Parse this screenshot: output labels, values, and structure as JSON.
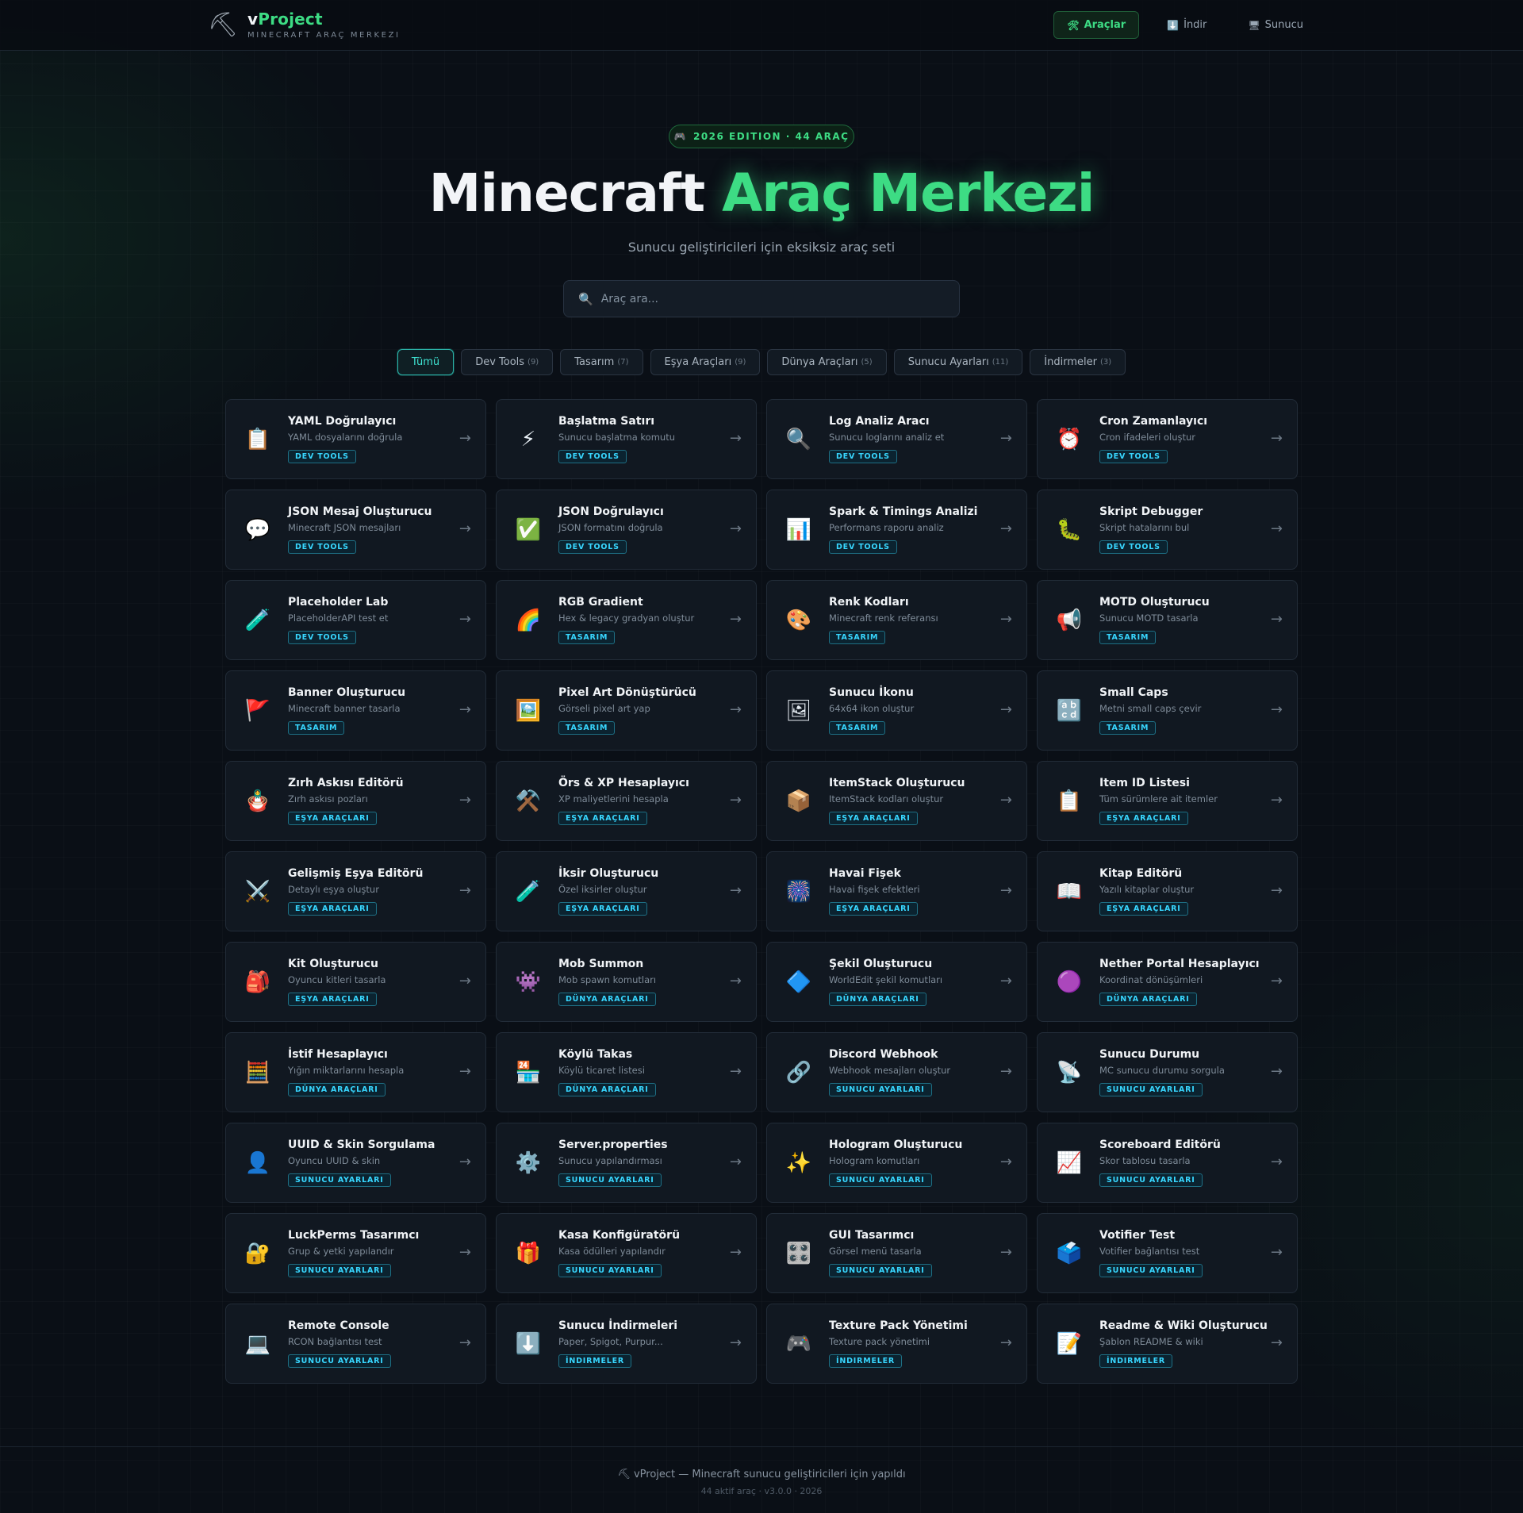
{
  "header": {
    "brand_icon": "⛏",
    "brand_prefix": "v",
    "brand_name": "Project",
    "brand_sub": "MINECRAFT ARAÇ MERKEZI",
    "nav": [
      {
        "icon": "🛠",
        "label": "Araçlar",
        "active": true
      },
      {
        "icon": "⬇️",
        "label": "İndir",
        "active": false
      },
      {
        "icon": "🖥",
        "label": "Sunucu",
        "active": false
      }
    ]
  },
  "hero": {
    "badge_icon": "🎮",
    "badge_text": "2026 EDITION · 44 ARAÇ",
    "title_white": "Minecraft ",
    "title_green": "Araç Merkezi",
    "subtitle": "Sunucu geliştiricileri için eksiksiz araç seti"
  },
  "search": {
    "placeholder": "Araç ara...",
    "value": ""
  },
  "filters": [
    {
      "label": "Tümü",
      "count": "",
      "active": true
    },
    {
      "label": "Dev Tools",
      "count": "(9)",
      "active": false
    },
    {
      "label": "Tasarım",
      "count": "(7)",
      "active": false
    },
    {
      "label": "Eşya Araçları",
      "count": "(9)",
      "active": false
    },
    {
      "label": "Dünya Araçları",
      "count": "(5)",
      "active": false
    },
    {
      "label": "Sunucu Ayarları",
      "count": "(11)",
      "active": false
    },
    {
      "label": "İndirmeler",
      "count": "(3)",
      "active": false
    }
  ],
  "tools": [
    {
      "icon": "📋",
      "title": "YAML Doğrulayıcı",
      "desc": "YAML dosyalarını doğrula",
      "tag": "DEV TOOLS"
    },
    {
      "icon": "⚡",
      "title": "Başlatma Satırı",
      "desc": "Sunucu başlatma komutu",
      "tag": "DEV TOOLS"
    },
    {
      "icon": "🔍",
      "title": "Log Analiz Aracı",
      "desc": "Sunucu loglarını analiz et",
      "tag": "DEV TOOLS"
    },
    {
      "icon": "⏰",
      "title": "Cron Zamanlayıcı",
      "desc": "Cron ifadeleri oluştur",
      "tag": "DEV TOOLS"
    },
    {
      "icon": "💬",
      "title": "JSON Mesaj Oluşturucu",
      "desc": "Minecraft JSON mesajları",
      "tag": "DEV TOOLS"
    },
    {
      "icon": "✅",
      "title": "JSON Doğrulayıcı",
      "desc": "JSON formatını doğrula",
      "tag": "DEV TOOLS"
    },
    {
      "icon": "📊",
      "title": "Spark & Timings Analizi",
      "desc": "Performans raporu analiz",
      "tag": "DEV TOOLS"
    },
    {
      "icon": "🐛",
      "title": "Skript Debugger",
      "desc": "Skript hatalarını bul",
      "tag": "DEV TOOLS"
    },
    {
      "icon": "🧪",
      "title": "Placeholder Lab",
      "desc": "PlaceholderAPI test et",
      "tag": "DEV TOOLS"
    },
    {
      "icon": "🌈",
      "title": "RGB Gradient",
      "desc": "Hex & legacy gradyan oluştur",
      "tag": "TASARIM"
    },
    {
      "icon": "🎨",
      "title": "Renk Kodları",
      "desc": "Minecraft renk referansı",
      "tag": "TASARIM"
    },
    {
      "icon": "📢",
      "title": "MOTD Oluşturucu",
      "desc": "Sunucu MOTD tasarla",
      "tag": "TASARIM"
    },
    {
      "icon": "🚩",
      "title": "Banner Oluşturucu",
      "desc": "Minecraft banner tasarla",
      "tag": "TASARIM"
    },
    {
      "icon": "🖼️",
      "title": "Pixel Art Dönüştürücü",
      "desc": "Görseli pixel art yap",
      "tag": "TASARIM"
    },
    {
      "icon": "🖼",
      "title": "Sunucu İkonu",
      "desc": "64x64 ikon oluştur",
      "tag": "TASARIM"
    },
    {
      "icon": "🔡",
      "title": "Small Caps",
      "desc": "Metni small caps çevir",
      "tag": "TASARIM"
    },
    {
      "icon": "🪆",
      "title": "Zırh Askısı Editörü",
      "desc": "Zırh askısı pozları",
      "tag": "EŞYA ARAÇLARI"
    },
    {
      "icon": "⚒️",
      "title": "Örs & XP Hesaplayıcı",
      "desc": "XP maliyetlerini hesapla",
      "tag": "EŞYA ARAÇLARI"
    },
    {
      "icon": "📦",
      "title": "ItemStack Oluşturucu",
      "desc": "ItemStack kodları oluştur",
      "tag": "EŞYA ARAÇLARI"
    },
    {
      "icon": "📋",
      "title": "Item ID Listesi",
      "desc": "Tüm sürümlere ait itemler",
      "tag": "EŞYA ARAÇLARI"
    },
    {
      "icon": "⚔️",
      "title": "Gelişmiş Eşya Editörü",
      "desc": "Detaylı eşya oluştur",
      "tag": "EŞYA ARAÇLARI"
    },
    {
      "icon": "🧪",
      "title": "İksir Oluşturucu",
      "desc": "Özel iksirler oluştur",
      "tag": "EŞYA ARAÇLARI"
    },
    {
      "icon": "🎆",
      "title": "Havai Fişek",
      "desc": "Havai fişek efektleri",
      "tag": "EŞYA ARAÇLARI"
    },
    {
      "icon": "📖",
      "title": "Kitap Editörü",
      "desc": "Yazılı kitaplar oluştur",
      "tag": "EŞYA ARAÇLARI"
    },
    {
      "icon": "🎒",
      "title": "Kit Oluşturucu",
      "desc": "Oyuncu kitleri tasarla",
      "tag": "EŞYA ARAÇLARI"
    },
    {
      "icon": "👾",
      "title": "Mob Summon",
      "desc": "Mob spawn komutları",
      "tag": "DÜNYA ARAÇLARI"
    },
    {
      "icon": "🔷",
      "title": "Şekil Oluşturucu",
      "desc": "WorldEdit şekil komutları",
      "tag": "DÜNYA ARAÇLARI"
    },
    {
      "icon": "🟣",
      "title": "Nether Portal Hesaplayıcı",
      "desc": "Koordinat dönüşümleri",
      "tag": "DÜNYA ARAÇLARI"
    },
    {
      "icon": "🧮",
      "title": "İstif Hesaplayıcı",
      "desc": "Yığın miktarlarını hesapla",
      "tag": "DÜNYA ARAÇLARI"
    },
    {
      "icon": "🏪",
      "title": "Köylü Takas",
      "desc": "Köylü ticaret listesi",
      "tag": "DÜNYA ARAÇLARI"
    },
    {
      "icon": "🔗",
      "title": "Discord Webhook",
      "desc": "Webhook mesajları oluştur",
      "tag": "SUNUCU AYARLARI"
    },
    {
      "icon": "📡",
      "title": "Sunucu Durumu",
      "desc": "MC sunucu durumu sorgula",
      "tag": "SUNUCU AYARLARI"
    },
    {
      "icon": "👤",
      "title": "UUID & Skin Sorgulama",
      "desc": "Oyuncu UUID & skin",
      "tag": "SUNUCU AYARLARI"
    },
    {
      "icon": "⚙️",
      "title": "Server.properties",
      "desc": "Sunucu yapılandırması",
      "tag": "SUNUCU AYARLARI"
    },
    {
      "icon": "✨",
      "title": "Hologram Oluşturucu",
      "desc": "Hologram komutları",
      "tag": "SUNUCU AYARLARI"
    },
    {
      "icon": "📈",
      "title": "Scoreboard Editörü",
      "desc": "Skor tablosu tasarla",
      "tag": "SUNUCU AYARLARI"
    },
    {
      "icon": "🔐",
      "title": "LuckPerms Tasarımcı",
      "desc": "Grup & yetki yapılandır",
      "tag": "SUNUCU AYARLARI"
    },
    {
      "icon": "🎁",
      "title": "Kasa Konfigüratörü",
      "desc": "Kasa ödülleri yapılandır",
      "tag": "SUNUCU AYARLARI"
    },
    {
      "icon": "🎛️",
      "title": "GUI Tasarımcı",
      "desc": "Görsel menü tasarla",
      "tag": "SUNUCU AYARLARI"
    },
    {
      "icon": "🗳️",
      "title": "Votifier Test",
      "desc": "Votifier bağlantısı test",
      "tag": "SUNUCU AYARLARI"
    },
    {
      "icon": "💻",
      "title": "Remote Console",
      "desc": "RCON bağlantısı test",
      "tag": "SUNUCU AYARLARI"
    },
    {
      "icon": "⬇️",
      "title": "Sunucu İndirmeleri",
      "desc": "Paper, Spigot, Purpur...",
      "tag": "İNDIRMELER"
    },
    {
      "icon": "🎮",
      "title": "Texture Pack Yönetimi",
      "desc": "Texture pack yönetimi",
      "tag": "İNDIRMELER"
    },
    {
      "icon": "📝",
      "title": "Readme & Wiki Oluşturucu",
      "desc": "Şablon README & wiki",
      "tag": "İNDIRMELER"
    }
  ],
  "card_arrow": "→",
  "footer": {
    "main": "⛏ vProject — Minecraft sunucu geliştiricileri için yapıldı",
    "sub": "44 aktif araç · v3.0.0 · 2026"
  }
}
